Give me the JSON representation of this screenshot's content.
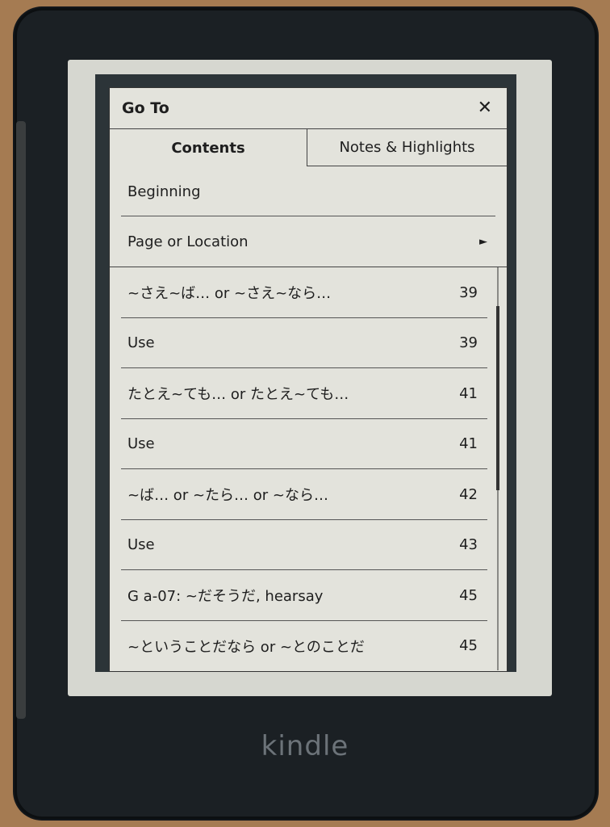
{
  "device": {
    "brand": "kindle"
  },
  "dialog": {
    "title": "Go To",
    "tabs": [
      {
        "label": "Contents",
        "active": true
      },
      {
        "label": "Notes & Highlights",
        "active": false
      }
    ],
    "top_items": [
      {
        "label": "Beginning"
      },
      {
        "label": "Page or Location"
      }
    ],
    "toc": [
      {
        "label": "~さえ~ば… or ~さえ~なら…",
        "page": "39"
      },
      {
        "label": "Use",
        "page": "39"
      },
      {
        "label": "たとえ~ても… or たとえ~ても…",
        "page": "41"
      },
      {
        "label": "Use",
        "page": "41"
      },
      {
        "label": "~ば… or ~たら… or ~なら…",
        "page": "42"
      },
      {
        "label": "Use",
        "page": "43"
      },
      {
        "label": "G a-07: ~だそうだ, hearsay",
        "page": "45"
      },
      {
        "label": "~ということだなら or ~とのことだ",
        "page": "45"
      }
    ]
  }
}
